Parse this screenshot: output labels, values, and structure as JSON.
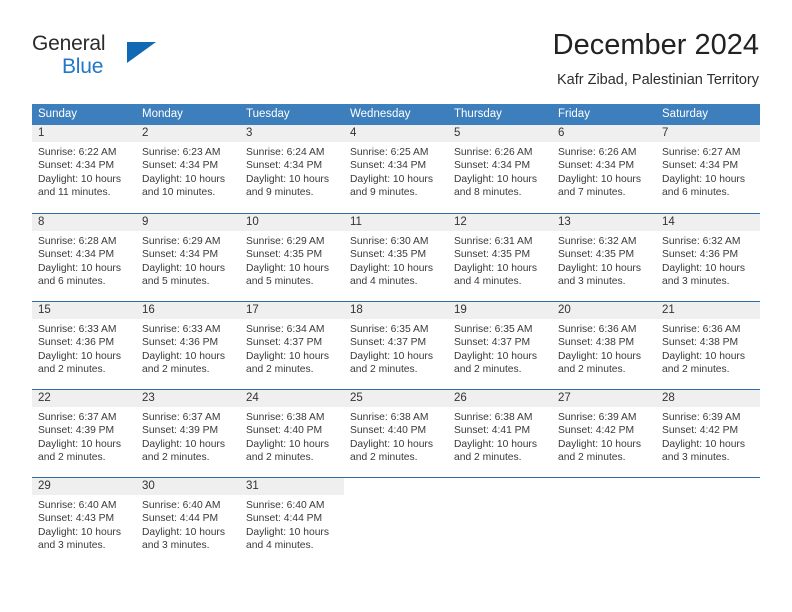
{
  "branding": {
    "name_top": "General",
    "name_bottom": "Blue",
    "triangle_color": "#1168b3",
    "text_color": "#2277c8"
  },
  "header": {
    "title": "December 2024",
    "subtitle": "Kafr Zibad, Palestinian Territory"
  },
  "theme": {
    "header_bg": "#3d7ebd",
    "header_text": "#ffffff",
    "day_band_bg": "#efefef",
    "row_divider": "#2c6ca8",
    "body_text": "#3a3a3a"
  },
  "weekdays": [
    "Sunday",
    "Monday",
    "Tuesday",
    "Wednesday",
    "Thursday",
    "Friday",
    "Saturday"
  ],
  "calendar_weeks": [
    [
      {
        "day": "1",
        "sunrise": "Sunrise: 6:22 AM",
        "sunset": "Sunset: 4:34 PM",
        "daylight1": "Daylight: 10 hours",
        "daylight2": "and 11 minutes."
      },
      {
        "day": "2",
        "sunrise": "Sunrise: 6:23 AM",
        "sunset": "Sunset: 4:34 PM",
        "daylight1": "Daylight: 10 hours",
        "daylight2": "and 10 minutes."
      },
      {
        "day": "3",
        "sunrise": "Sunrise: 6:24 AM",
        "sunset": "Sunset: 4:34 PM",
        "daylight1": "Daylight: 10 hours",
        "daylight2": "and 9 minutes."
      },
      {
        "day": "4",
        "sunrise": "Sunrise: 6:25 AM",
        "sunset": "Sunset: 4:34 PM",
        "daylight1": "Daylight: 10 hours",
        "daylight2": "and 9 minutes."
      },
      {
        "day": "5",
        "sunrise": "Sunrise: 6:26 AM",
        "sunset": "Sunset: 4:34 PM",
        "daylight1": "Daylight: 10 hours",
        "daylight2": "and 8 minutes."
      },
      {
        "day": "6",
        "sunrise": "Sunrise: 6:26 AM",
        "sunset": "Sunset: 4:34 PM",
        "daylight1": "Daylight: 10 hours",
        "daylight2": "and 7 minutes."
      },
      {
        "day": "7",
        "sunrise": "Sunrise: 6:27 AM",
        "sunset": "Sunset: 4:34 PM",
        "daylight1": "Daylight: 10 hours",
        "daylight2": "and 6 minutes."
      }
    ],
    [
      {
        "day": "8",
        "sunrise": "Sunrise: 6:28 AM",
        "sunset": "Sunset: 4:34 PM",
        "daylight1": "Daylight: 10 hours",
        "daylight2": "and 6 minutes."
      },
      {
        "day": "9",
        "sunrise": "Sunrise: 6:29 AM",
        "sunset": "Sunset: 4:34 PM",
        "daylight1": "Daylight: 10 hours",
        "daylight2": "and 5 minutes."
      },
      {
        "day": "10",
        "sunrise": "Sunrise: 6:29 AM",
        "sunset": "Sunset: 4:35 PM",
        "daylight1": "Daylight: 10 hours",
        "daylight2": "and 5 minutes."
      },
      {
        "day": "11",
        "sunrise": "Sunrise: 6:30 AM",
        "sunset": "Sunset: 4:35 PM",
        "daylight1": "Daylight: 10 hours",
        "daylight2": "and 4 minutes."
      },
      {
        "day": "12",
        "sunrise": "Sunrise: 6:31 AM",
        "sunset": "Sunset: 4:35 PM",
        "daylight1": "Daylight: 10 hours",
        "daylight2": "and 4 minutes."
      },
      {
        "day": "13",
        "sunrise": "Sunrise: 6:32 AM",
        "sunset": "Sunset: 4:35 PM",
        "daylight1": "Daylight: 10 hours",
        "daylight2": "and 3 minutes."
      },
      {
        "day": "14",
        "sunrise": "Sunrise: 6:32 AM",
        "sunset": "Sunset: 4:36 PM",
        "daylight1": "Daylight: 10 hours",
        "daylight2": "and 3 minutes."
      }
    ],
    [
      {
        "day": "15",
        "sunrise": "Sunrise: 6:33 AM",
        "sunset": "Sunset: 4:36 PM",
        "daylight1": "Daylight: 10 hours",
        "daylight2": "and 2 minutes."
      },
      {
        "day": "16",
        "sunrise": "Sunrise: 6:33 AM",
        "sunset": "Sunset: 4:36 PM",
        "daylight1": "Daylight: 10 hours",
        "daylight2": "and 2 minutes."
      },
      {
        "day": "17",
        "sunrise": "Sunrise: 6:34 AM",
        "sunset": "Sunset: 4:37 PM",
        "daylight1": "Daylight: 10 hours",
        "daylight2": "and 2 minutes."
      },
      {
        "day": "18",
        "sunrise": "Sunrise: 6:35 AM",
        "sunset": "Sunset: 4:37 PM",
        "daylight1": "Daylight: 10 hours",
        "daylight2": "and 2 minutes."
      },
      {
        "day": "19",
        "sunrise": "Sunrise: 6:35 AM",
        "sunset": "Sunset: 4:37 PM",
        "daylight1": "Daylight: 10 hours",
        "daylight2": "and 2 minutes."
      },
      {
        "day": "20",
        "sunrise": "Sunrise: 6:36 AM",
        "sunset": "Sunset: 4:38 PM",
        "daylight1": "Daylight: 10 hours",
        "daylight2": "and 2 minutes."
      },
      {
        "day": "21",
        "sunrise": "Sunrise: 6:36 AM",
        "sunset": "Sunset: 4:38 PM",
        "daylight1": "Daylight: 10 hours",
        "daylight2": "and 2 minutes."
      }
    ],
    [
      {
        "day": "22",
        "sunrise": "Sunrise: 6:37 AM",
        "sunset": "Sunset: 4:39 PM",
        "daylight1": "Daylight: 10 hours",
        "daylight2": "and 2 minutes."
      },
      {
        "day": "23",
        "sunrise": "Sunrise: 6:37 AM",
        "sunset": "Sunset: 4:39 PM",
        "daylight1": "Daylight: 10 hours",
        "daylight2": "and 2 minutes."
      },
      {
        "day": "24",
        "sunrise": "Sunrise: 6:38 AM",
        "sunset": "Sunset: 4:40 PM",
        "daylight1": "Daylight: 10 hours",
        "daylight2": "and 2 minutes."
      },
      {
        "day": "25",
        "sunrise": "Sunrise: 6:38 AM",
        "sunset": "Sunset: 4:40 PM",
        "daylight1": "Daylight: 10 hours",
        "daylight2": "and 2 minutes."
      },
      {
        "day": "26",
        "sunrise": "Sunrise: 6:38 AM",
        "sunset": "Sunset: 4:41 PM",
        "daylight1": "Daylight: 10 hours",
        "daylight2": "and 2 minutes."
      },
      {
        "day": "27",
        "sunrise": "Sunrise: 6:39 AM",
        "sunset": "Sunset: 4:42 PM",
        "daylight1": "Daylight: 10 hours",
        "daylight2": "and 2 minutes."
      },
      {
        "day": "28",
        "sunrise": "Sunrise: 6:39 AM",
        "sunset": "Sunset: 4:42 PM",
        "daylight1": "Daylight: 10 hours",
        "daylight2": "and 3 minutes."
      }
    ],
    [
      {
        "day": "29",
        "sunrise": "Sunrise: 6:40 AM",
        "sunset": "Sunset: 4:43 PM",
        "daylight1": "Daylight: 10 hours",
        "daylight2": "and 3 minutes."
      },
      {
        "day": "30",
        "sunrise": "Sunrise: 6:40 AM",
        "sunset": "Sunset: 4:44 PM",
        "daylight1": "Daylight: 10 hours",
        "daylight2": "and 3 minutes."
      },
      {
        "day": "31",
        "sunrise": "Sunrise: 6:40 AM",
        "sunset": "Sunset: 4:44 PM",
        "daylight1": "Daylight: 10 hours",
        "daylight2": "and 4 minutes."
      },
      {
        "day": "",
        "sunrise": "",
        "sunset": "",
        "daylight1": "",
        "daylight2": ""
      },
      {
        "day": "",
        "sunrise": "",
        "sunset": "",
        "daylight1": "",
        "daylight2": ""
      },
      {
        "day": "",
        "sunrise": "",
        "sunset": "",
        "daylight1": "",
        "daylight2": ""
      },
      {
        "day": "",
        "sunrise": "",
        "sunset": "",
        "daylight1": "",
        "daylight2": ""
      }
    ]
  ]
}
